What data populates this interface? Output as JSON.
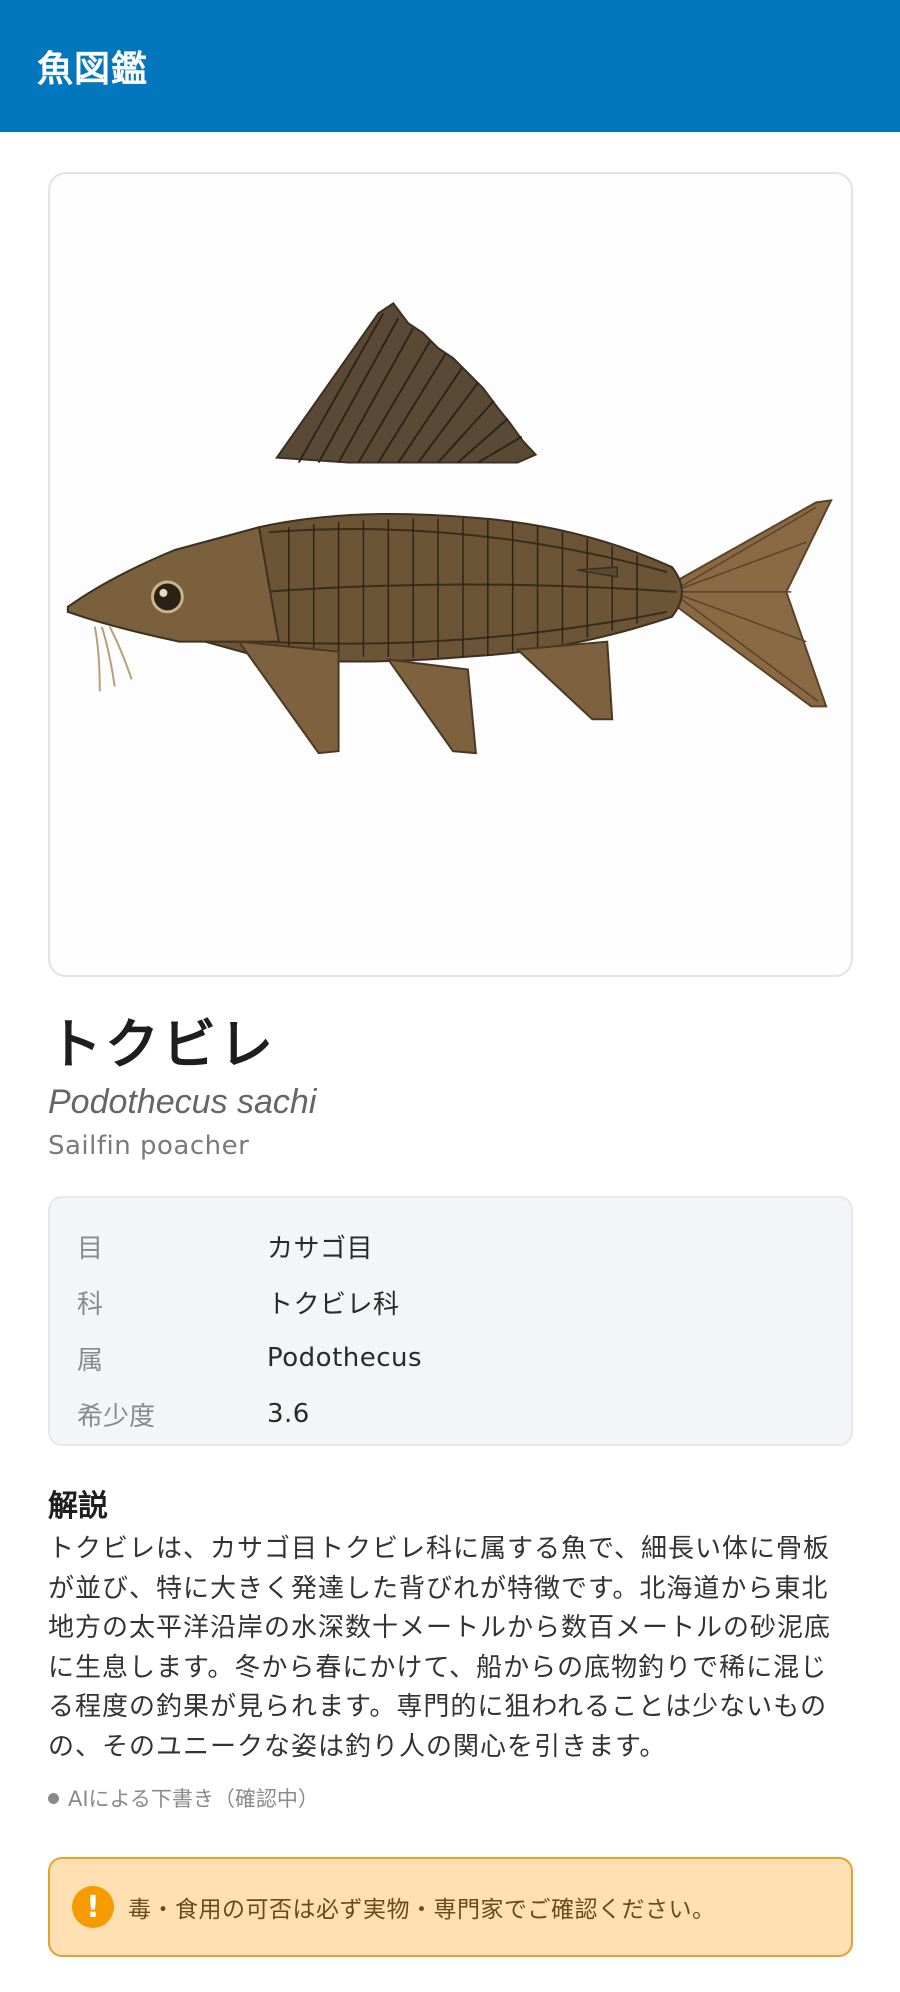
{
  "app_bar": {
    "title": "魚図鑑"
  },
  "fish": {
    "jp_name": "トクビレ",
    "scientific_name": "Podothecus sachi",
    "english_name": "Sailfin poacher",
    "image_icon": "fish-illustration"
  },
  "taxonomy": [
    {
      "label": "目",
      "value": "カサゴ目"
    },
    {
      "label": "科",
      "value": "トクビレ科"
    },
    {
      "label": "属",
      "value": "Podothecus"
    },
    {
      "label": "希少度",
      "value": "3.6"
    }
  ],
  "description": {
    "title": "解説",
    "body": "トクビレは、カサゴ目トクビレ科に属する魚で、細長い体に骨板が並び、特に大きく発達した背びれが特徴です。北海道から東北地方の太平洋沿岸の水深数十メートルから数百メートルの砂泥底に生息します。冬から春にかけて、船からの底物釣りで稀に混じる程度の釣果が見られます。専門的に狙われることは少ないものの、そのユニークな姿は釣り人の関心を引きます。",
    "draft_note": "AIによる下書き（確認中）"
  },
  "warning": {
    "icon": "exclamation-icon",
    "text": "毒・食用の可否は必ず実物・専門家でご確認ください。"
  },
  "colors": {
    "app_bar": "#0277BD",
    "warning_bg": "#FFE0B2",
    "warning_border": "#E7A12E",
    "warning_icon": "#F59B00"
  }
}
